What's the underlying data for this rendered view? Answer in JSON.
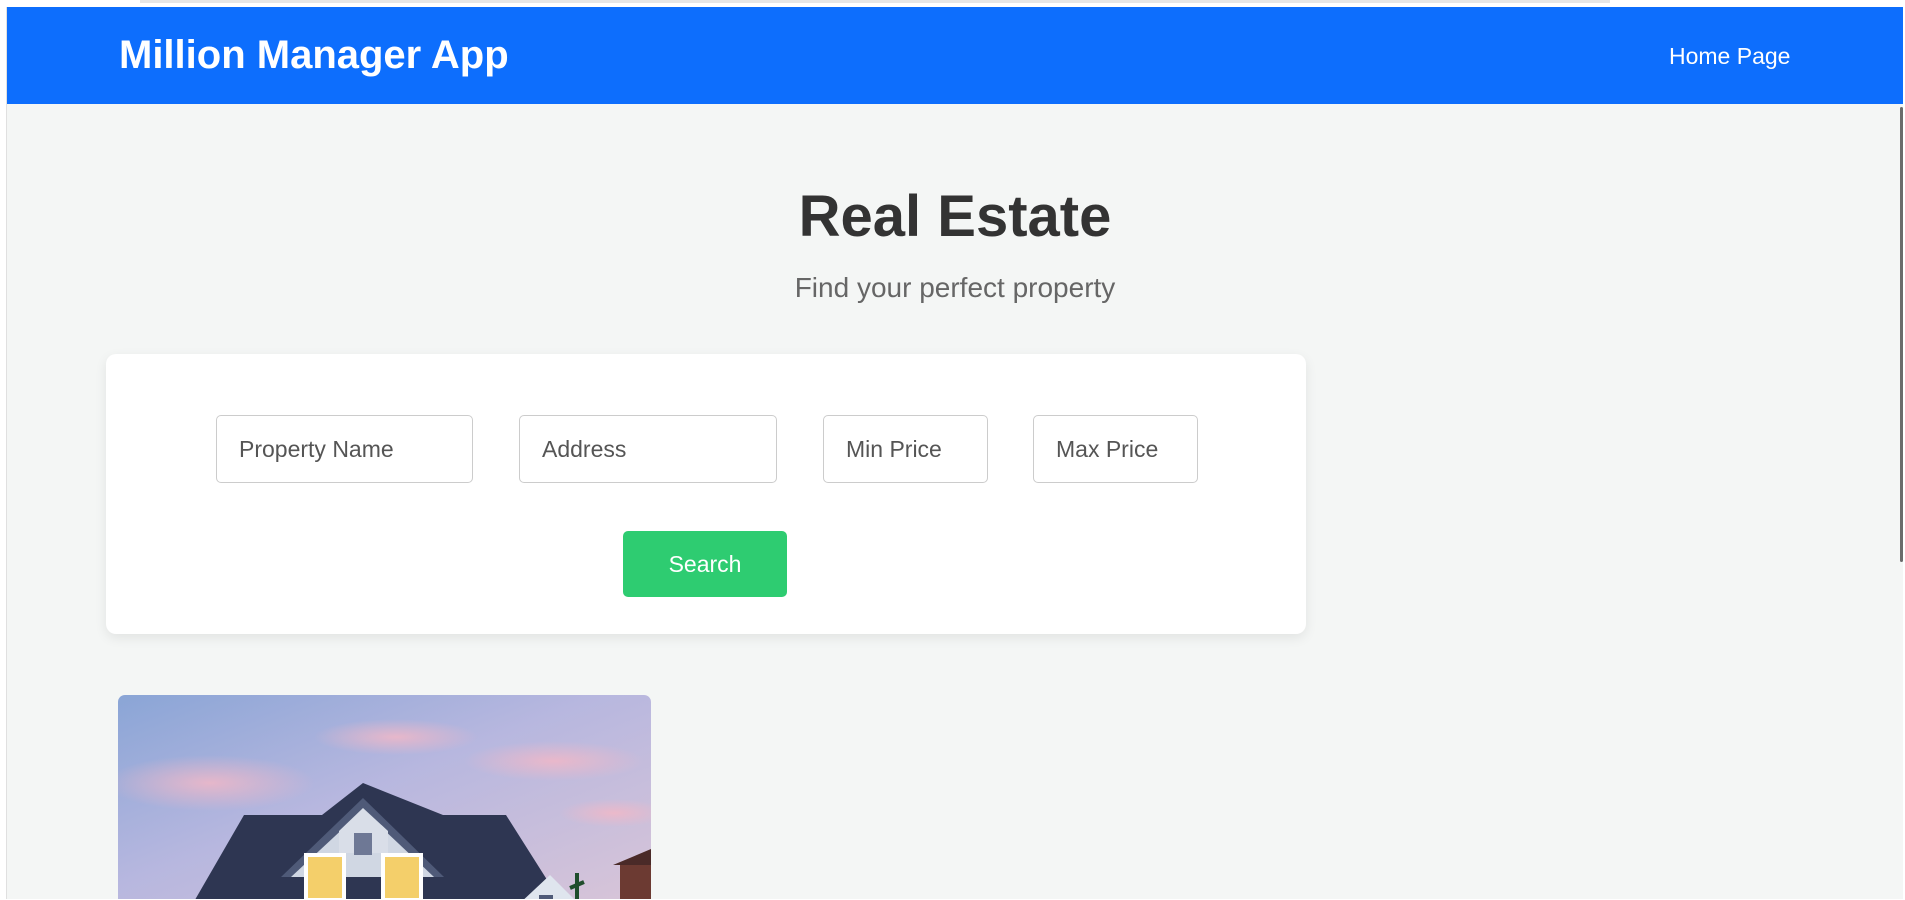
{
  "navbar": {
    "brand": "Million Manager App",
    "home_link": "Home Page",
    "background_color": "#0d6efd"
  },
  "hero": {
    "title": "Real Estate",
    "subtitle": "Find your perfect property"
  },
  "search": {
    "property_name_placeholder": "Property Name",
    "address_placeholder": "Address",
    "min_price_placeholder": "Min Price",
    "max_price_placeholder": "Max Price",
    "search_label": "Search",
    "button_color": "#2ecc71"
  },
  "listing": {
    "image_icon": "house-photo"
  }
}
